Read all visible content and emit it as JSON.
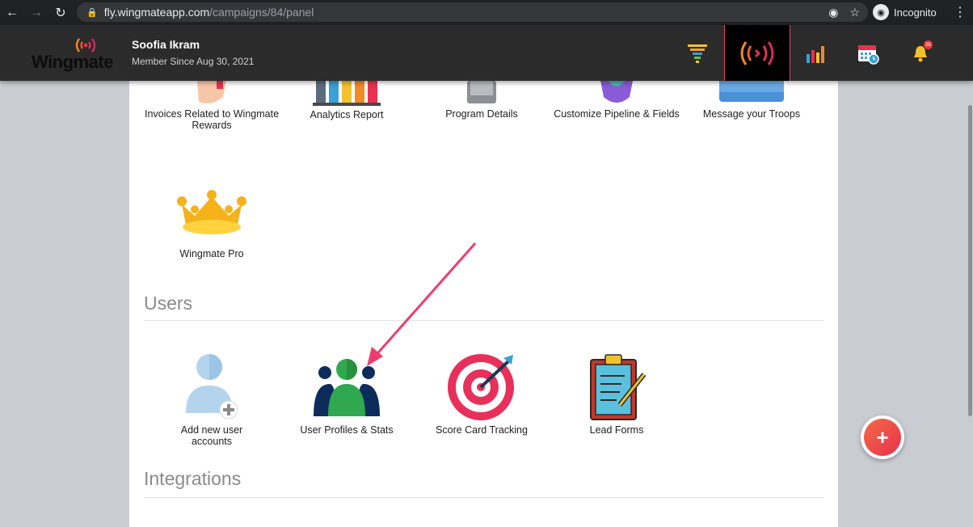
{
  "browser": {
    "url_host": "fly.wingmateapp.com",
    "url_path": "/campaigns/84/panel",
    "incognito_label": "Incognito"
  },
  "header": {
    "logo_text": "Wingmate",
    "user_name": "Soofia Ikram",
    "member_since": "Member Since Aug 30, 2021",
    "notification_count": "36"
  },
  "tiles_top": [
    {
      "label": "Invoices Related to Wingmate Rewards"
    },
    {
      "label": "Analytics Report"
    },
    {
      "label": "Program Details"
    },
    {
      "label": "Customize Pipeline & Fields"
    },
    {
      "label": "Message your Troops"
    }
  ],
  "tile_pro": {
    "label": "Wingmate Pro"
  },
  "sections": {
    "users_title": "Users",
    "integrations_title": "Integrations"
  },
  "user_tiles": [
    {
      "label": "Add new user accounts"
    },
    {
      "label": "User Profiles & Stats"
    },
    {
      "label": "Score Card Tracking"
    },
    {
      "label": "Lead Forms"
    }
  ],
  "fab_icon": "plus-icon",
  "colors": {
    "header_bg": "#2b2b2b",
    "accent": "#e8304f",
    "section_text": "#8a8a8a"
  }
}
